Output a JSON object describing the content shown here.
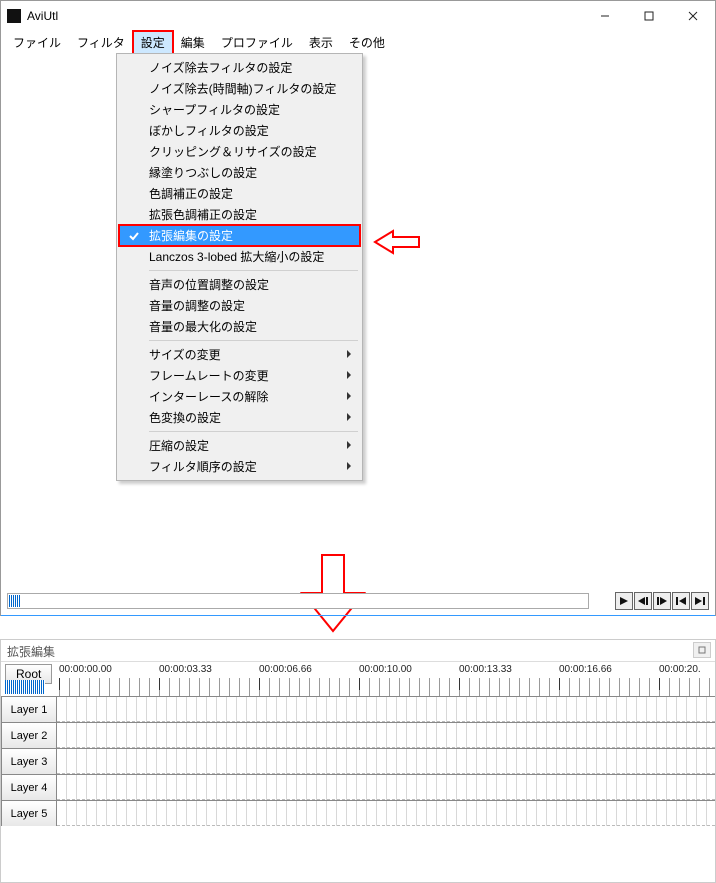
{
  "app": {
    "title": "AviUtl"
  },
  "menu": {
    "items": [
      "ファイル",
      "フィルタ",
      "設定",
      "編集",
      "プロファイル",
      "表示",
      "その他"
    ],
    "open_index": 2
  },
  "dropdown": {
    "groups": [
      [
        "ノイズ除去フィルタの設定",
        "ノイズ除去(時間軸)フィルタの設定",
        "シャープフィルタの設定",
        "ぼかしフィルタの設定",
        "クリッピング＆リサイズの設定",
        "縁塗りつぶしの設定",
        "色調補正の設定",
        "拡張色調補正の設定",
        "拡張編集の設定",
        "Lanczos 3-lobed 拡大縮小の設定"
      ],
      [
        "音声の位置調整の設定",
        "音量の調整の設定",
        "音量の最大化の設定"
      ],
      [
        "サイズの変更",
        "フレームレートの変更",
        "インターレースの解除",
        "色変換の設定"
      ],
      [
        "圧縮の設定",
        "フィルタ順序の設定"
      ]
    ],
    "selected": "拡張編集の設定",
    "checked": [
      "拡張編集の設定"
    ],
    "submenu": [
      "サイズの変更",
      "フレームレートの変更",
      "インターレースの解除",
      "色変換の設定",
      "圧縮の設定",
      "フィルタ順序の設定"
    ]
  },
  "ext": {
    "title": "拡張編集",
    "root": "Root",
    "ruler": [
      "00:00:00.00",
      "00:00:03.33",
      "00:00:06.66",
      "00:00:10.00",
      "00:00:13.33",
      "00:00:16.66",
      "00:00:20."
    ],
    "layers": [
      "Layer 1",
      "Layer 2",
      "Layer 3",
      "Layer 4",
      "Layer 5"
    ]
  },
  "controls": {
    "play": "▶",
    "back": "◀|",
    "fwd": "|▶",
    "start": "|◀",
    "end": "▶|"
  },
  "colors": {
    "accent": "#3399ff",
    "annot": "#ff0000"
  }
}
